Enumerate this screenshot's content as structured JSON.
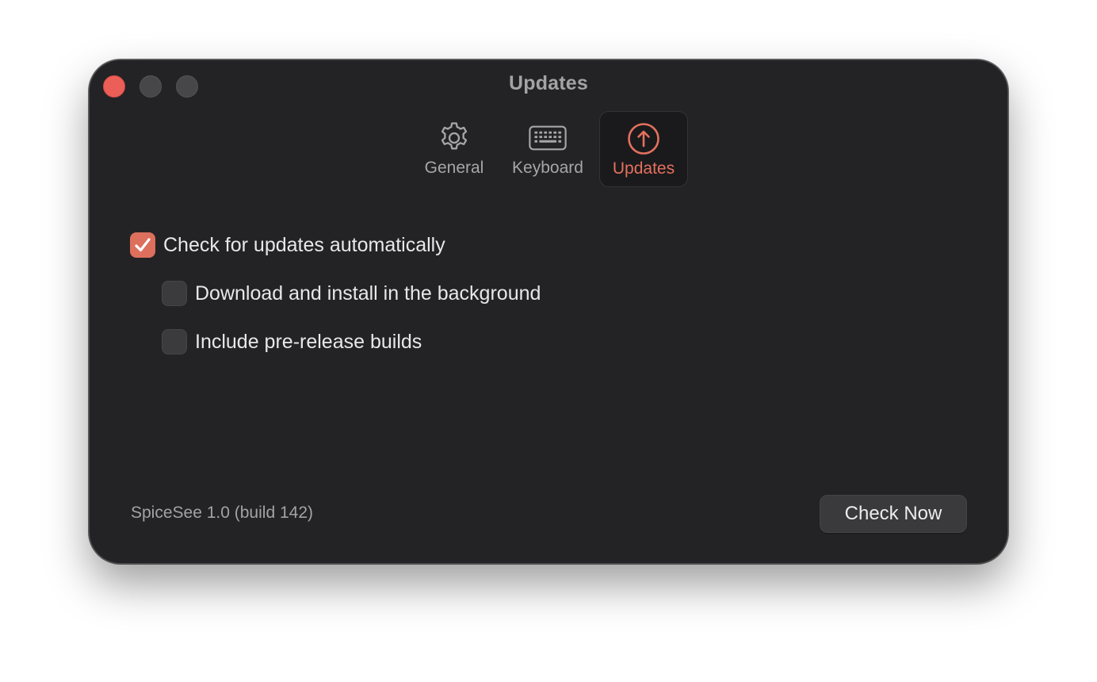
{
  "window": {
    "title": "Updates"
  },
  "toolbar": {
    "tabs": [
      {
        "label": "General",
        "icon": "gear-icon",
        "selected": false
      },
      {
        "label": "Keyboard",
        "icon": "keyboard-icon",
        "selected": false
      },
      {
        "label": "Updates",
        "icon": "arrow-up-circle-icon",
        "selected": true
      }
    ]
  },
  "options": [
    {
      "label": "Check for updates automatically",
      "checked": true
    },
    {
      "label": "Download and install in the background",
      "checked": false
    },
    {
      "label": "Include pre-release builds",
      "checked": false
    }
  ],
  "footer": {
    "version": "SpiceSee 1.0 (build 142)",
    "check_now_label": "Check Now"
  },
  "colors": {
    "accent": "#dd6f5d",
    "window_background": "#232325"
  }
}
